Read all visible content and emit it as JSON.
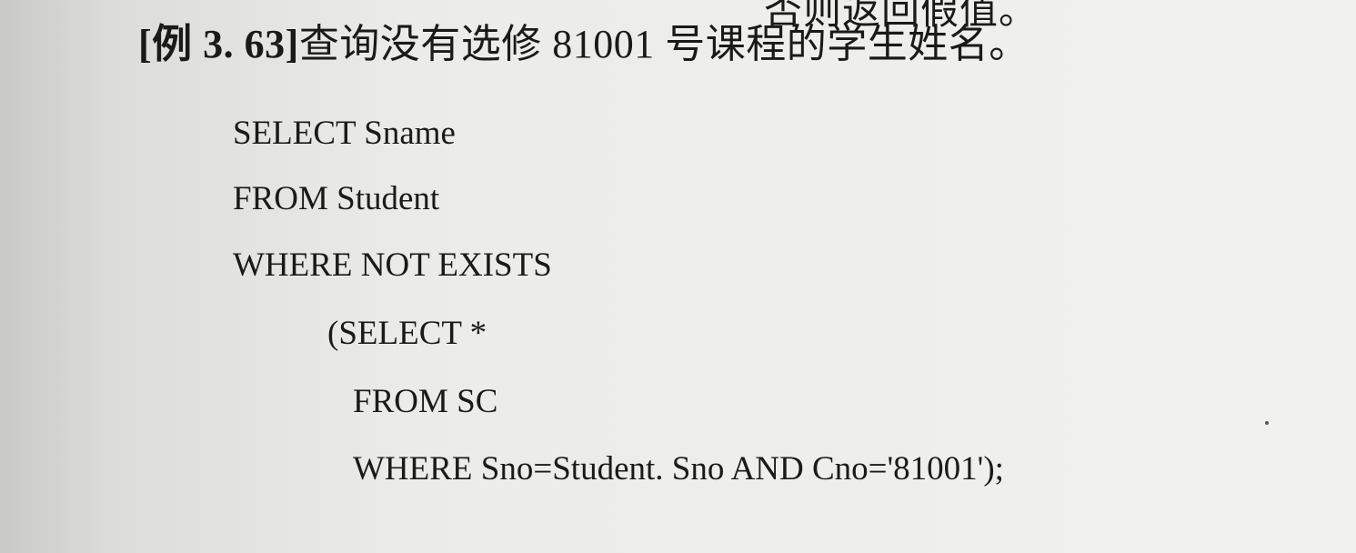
{
  "top_partial_text": "否则返回假值。",
  "example": {
    "label": "[例 3. 63]",
    "title": "查询没有选修 81001 号课程的学生姓名。"
  },
  "code": [
    "SELECT Sname",
    "FROM Student",
    "WHERE NOT EXISTS",
    "(SELECT *",
    "FROM SC",
    "WHERE Sno=Student. Sno AND Cno='81001');"
  ]
}
